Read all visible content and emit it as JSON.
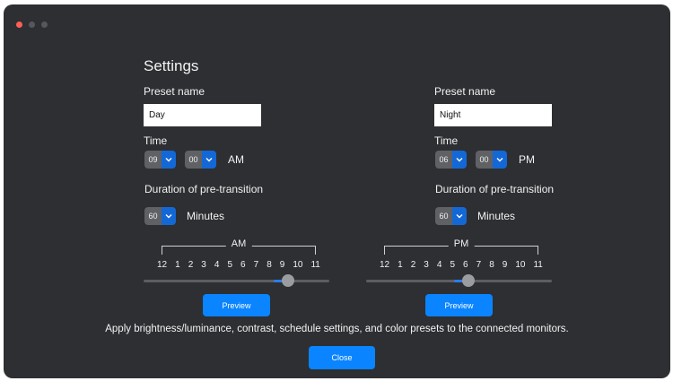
{
  "window": {
    "controls": [
      "close-dot",
      "minimize-dot",
      "zoom-dot"
    ]
  },
  "settings_title": "Settings",
  "presets": [
    {
      "name_label": "Preset name",
      "name_value": "Day",
      "time_label": "Time",
      "hour": "09",
      "minute": "00",
      "period": "AM",
      "duration_label": "Duration of pre-transition",
      "duration_value": "60",
      "duration_unit": "Minutes",
      "scale_period": "AM",
      "scale_ticks": [
        "12",
        "1",
        "2",
        "3",
        "4",
        "5",
        "6",
        "7",
        "8",
        "9",
        "10",
        "11"
      ],
      "slider_value_hour": 9,
      "slider_fill_from_hour": 8,
      "preview_label": "Preview"
    },
    {
      "name_label": "Preset name",
      "name_value": "Night",
      "time_label": "Time",
      "hour": "06",
      "minute": "00",
      "period": "PM",
      "duration_label": "Duration of pre-transition",
      "duration_value": "60",
      "duration_unit": "Minutes",
      "scale_period": "PM",
      "scale_ticks": [
        "12",
        "1",
        "2",
        "3",
        "4",
        "5",
        "6",
        "7",
        "8",
        "9",
        "10",
        "11"
      ],
      "slider_value_hour": 6,
      "slider_fill_from_hour": 5,
      "preview_label": "Preview"
    }
  ],
  "info_text": "Apply brightness/luminance, contrast, schedule settings, and color presets to the connected monitors.",
  "close_label": "Close",
  "colors": {
    "window_bg": "#2d2f32",
    "accent": "#0a84ff",
    "dropdown_arrow_bg": "#1468d6",
    "close_dot": "#fe5f57"
  }
}
